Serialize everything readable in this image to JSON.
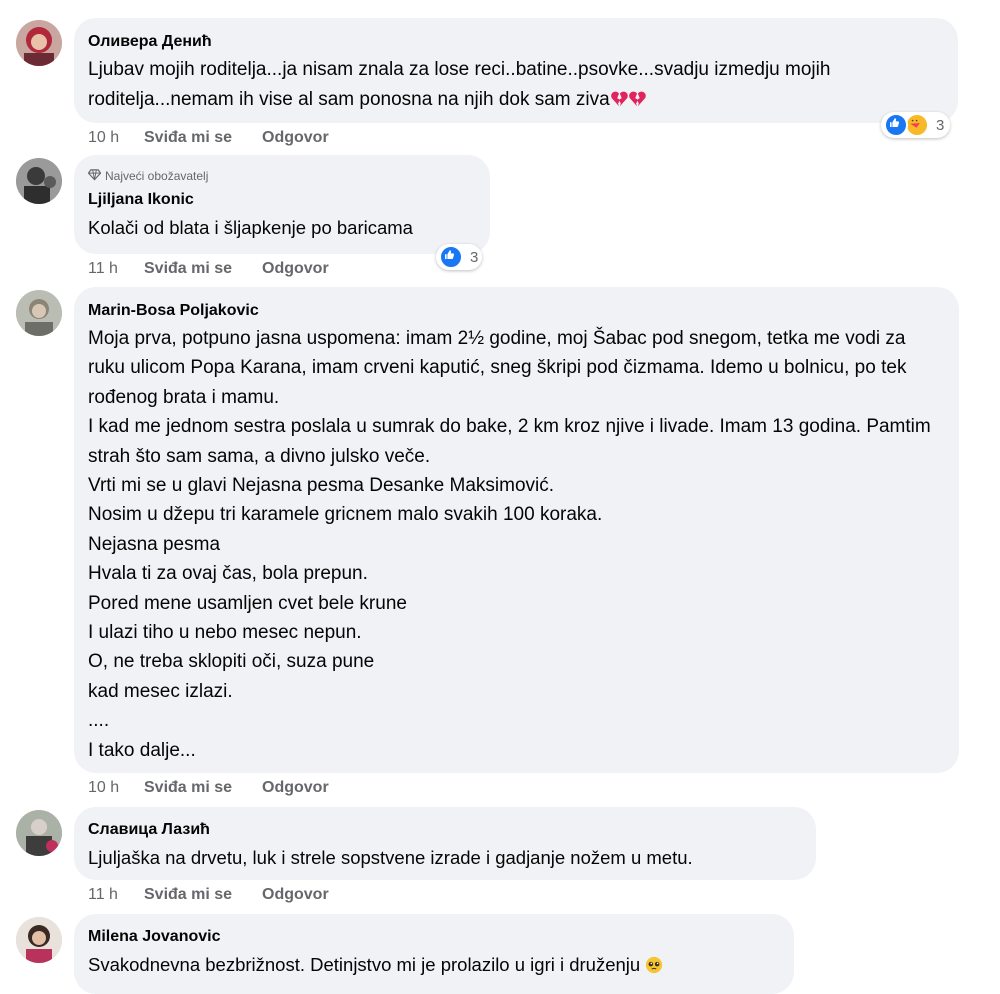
{
  "labels": {
    "like": "Sviđa mi se",
    "reply": "Odgovor"
  },
  "colors": {
    "bubble": "#f0f2f5",
    "meta": "#65676b",
    "like_blue": "#1877f2",
    "heart_red": "#e0245e"
  },
  "comments": [
    {
      "author": "Оливера Денић",
      "text": "Ljubav mojih roditelja...ja nisam znala za lose reci..batine..psovke...svadju izmedju mojih roditelja...nemam ih vise al sam ponosna na njih dok sam ziva",
      "emoji": [
        "broken-heart-icon",
        "broken-heart-icon"
      ],
      "time": "10 h",
      "reactions": {
        "icons": [
          "like-icon",
          "care-icon"
        ],
        "count": "3"
      }
    },
    {
      "badge": "Najveći obožavatelj",
      "author": "Ljiljana Ikonic",
      "text": "Kolači od blata i šljapkenje po baricama",
      "time": "11 h",
      "reactions": {
        "icons": [
          "like-icon"
        ],
        "count": "3"
      }
    },
    {
      "author": "Marin-Bosa Poljakovic",
      "text": "Moja prva, potpuno jasna uspomena: imam 2½ godine, moj Šabac pod snegom, tetka me vodi za ruku ulicom Popa Karana, imam crveni kaputić, sneg škripi pod čizmama. Idemo u bolnicu, po tek rođenog brata i mamu.\nI kad me jednom sestra poslala u sumrak do bake, 2 km kroz njive i livade. Imam 13 godina. Pamtim strah što sam sama, a divno julsko veče.\nVrti mi se u glavi Nejasna pesma Desanke Maksimović.\nNosim u džepu tri karamele gricnem malo svakih 100 koraka.\nNejasna pesma\nHvala ti za ovaj čas, bola prepun.\nPored mene usamljen cvet bele krune\nI ulazi tiho u nebo mesec nepun.\nO, ne treba sklopiti oči, suza pune\nkad mesec izlazi.\n....\nI tako dalje...",
      "time": "10 h"
    },
    {
      "author": "Славица Лазић",
      "text": "Ljuljaška na drvetu, luk i strele sopstvene izrade i gadjanje nožem u metu.",
      "time": "11 h"
    },
    {
      "author": "Milena Jovanovic",
      "text": "Svakodnevna bezbrižnost. Detinjstvo mi je prolazilo u igri i druženju",
      "emoji": [
        "pleading-face-icon"
      ]
    }
  ]
}
